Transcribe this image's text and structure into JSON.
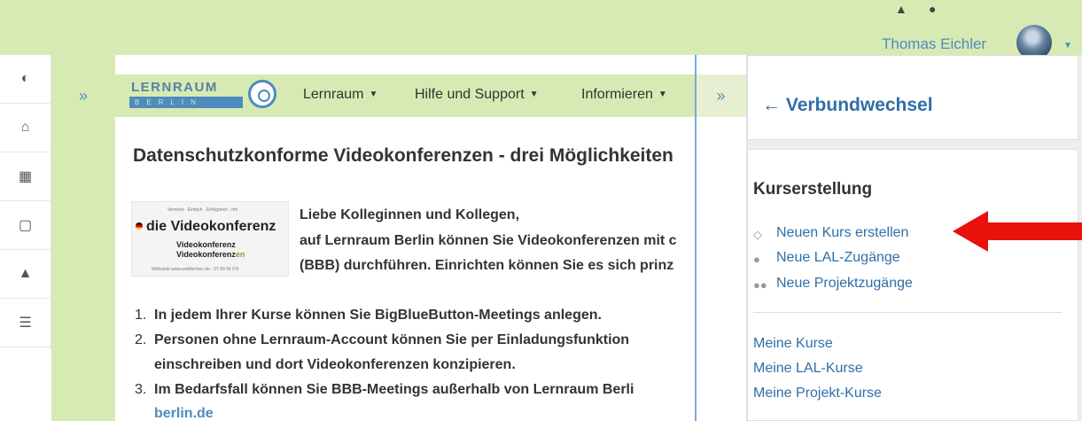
{
  "header": {
    "user_name": "Thomas Eichler",
    "bell_icon": "bell-icon",
    "chat_icon": "chat-icon"
  },
  "left_nav": {
    "items": [
      {
        "icon": "dashboard-icon",
        "glyph": "◐"
      },
      {
        "icon": "home-icon",
        "glyph": "⌂"
      },
      {
        "icon": "calendar-icon",
        "glyph": "▦"
      },
      {
        "icon": "file-icon",
        "glyph": "▢"
      },
      {
        "icon": "graduation-cap-icon",
        "glyph": "▲"
      },
      {
        "icon": "list-icon",
        "glyph": "☰"
      }
    ]
  },
  "main_nav": {
    "collapse": "»",
    "logo_top": "LERNRAUM",
    "logo_bottom": "BERLIN",
    "menu": [
      "Lernraum",
      "Hilfe und Support",
      "Informieren"
    ],
    "expand": "»"
  },
  "content": {
    "title": "Datenschutzkonforme Videokonferenzen - drei Möglichkeiten",
    "logo": {
      "tagline": "Vernetzt · Einfach · Erfolgreich · mit",
      "die": "die",
      "brand": "Videokonferenz",
      "line2": "Videokonferenz",
      "line3a": "Videokonferenz",
      "line3b": "en",
      "footer": "Webseite www.webformen.de · 07 99 56 0 8"
    },
    "intro1": "Liebe Kolleginnen und Kollegen,",
    "intro2a": "auf Lernraum Berlin können Sie Videokonferenzen mit c",
    "intro3": "(BBB) durchführen. Einrichten können Sie es sich prinz",
    "items": [
      {
        "n": "1.",
        "t": "In jedem Ihrer Kurse können Sie BigBlueButton-Meetings anlegen."
      },
      {
        "n": "2.",
        "t": "Personen ohne Lernraum-Account können Sie per Einladungsfunktion"
      },
      {
        "n": "",
        "t": "einschreiben und dort Videokonferenzen konzipieren."
      },
      {
        "n": "3.",
        "t": "Im Bedarfsfall können Sie BBB-Meetings außerhalb von Lernraum Berli"
      },
      {
        "n": "",
        "t": "berlin.de"
      }
    ]
  },
  "drawer": {
    "back_label": "Verbundwechsel",
    "block_title": "Kurserstellung",
    "links": [
      "Neuen Kurs erstellen",
      "Neue LAL-Zugänge",
      "Neue Projektzugänge"
    ],
    "plain_links": [
      "Meine Kurse",
      "Meine LAL-Kurse",
      "Meine Projekt-Kurse"
    ]
  },
  "colors": {
    "brand_green": "#d7eab3",
    "link_blue": "#2f6fa7",
    "arrow_red": "#e8110c"
  }
}
